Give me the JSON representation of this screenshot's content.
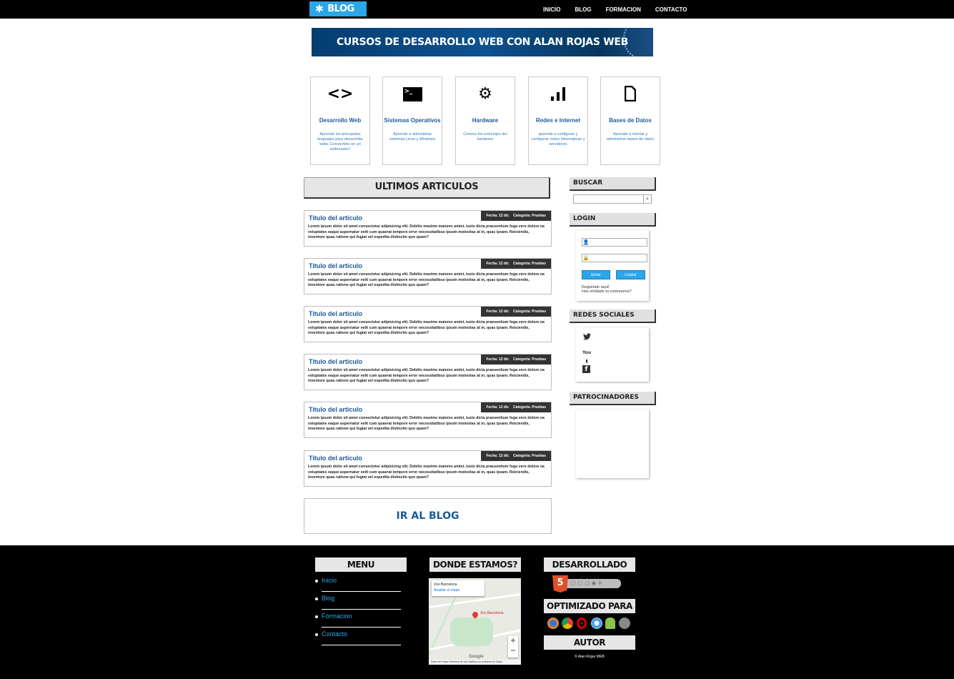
{
  "header": {
    "logo_label": "BLOG",
    "nav": [
      "INICIO",
      "BLOG",
      "FORMACION",
      "CONTACTO"
    ]
  },
  "banner": {
    "text": "CURSOS DE DESARROLLO WEB CON ALAN ROJAS WEB"
  },
  "categories": [
    {
      "icon": "code-icon",
      "title": "Desarrollo Web",
      "desc": "Aprende los principales lenguajes para desarrollar webs Conviertete en un webmaster!"
    },
    {
      "icon": "terminal-icon",
      "title": "Sistemas Operativos",
      "desc": "Aprende a administrar sistemas Linux y Windows"
    },
    {
      "icon": "gear-icon",
      "title": "Hardware",
      "desc": "Conoce los entresijos del hardware"
    },
    {
      "icon": "signal-bars-icon",
      "title": "Redes e Internet",
      "desc": "aprende a configurar y configurar redes informaticas y servidores"
    },
    {
      "icon": "file-icon",
      "title": "Bases de Datos",
      "desc": "Aprende a montar y administrar bases de datos"
    }
  ],
  "latest": {
    "heading": "ULTIMOS ARTICULOS",
    "articles": [
      {
        "title": "Titulo del articulo",
        "date": "Fecha: 12 dic",
        "category": "Categoria: Pruebas",
        "body": "Lorem ipsum dolor sit amet consectetur adipisicing elit. Debitis maxime maiores animi, iusto dicta praesentium fuga vero dolore ea voluptates eaque aspernatur velit cum quaerat tempore error necessitatibus ipsum molestias at in, quas ipsam. Reiciendis, inventore quas ratione qui fugiat vel expedita distinctio quo quam?"
      },
      {
        "title": "Titulo del articulo",
        "date": "Fecha: 12 dic",
        "category": "Categoria: Pruebas",
        "body": "Lorem ipsum dolor sit amet consectetur adipisicing elit. Debitis maxime maiores animi, iusto dicta praesentium fuga vero dolore ea voluptates eaque aspernatur velit cum quaerat tempore error necessitatibus ipsum molestias at in, quas ipsam. Reiciendis, inventore quas ratione qui fugiat vel expedita distinctio quo quam?"
      },
      {
        "title": "Titulo del articulo",
        "date": "Fecha: 12 dic",
        "category": "Categoria: Pruebas",
        "body": "Lorem ipsum dolor sit amet consectetur adipisicing elit. Debitis maxime maiores animi, iusto dicta praesentium fuga vero dolore ea voluptates eaque aspernatur velit cum quaerat tempore error necessitatibus ipsum molestias at in, quas ipsam. Reiciendis, inventore quas ratione qui fugiat vel expedita distinctio quo quam?"
      },
      {
        "title": "Titulo del articulo",
        "date": "Fecha: 12 dic",
        "category": "Categoria: Pruebas",
        "body": "Lorem ipsum dolor sit amet consectetur adipisicing elit. Debitis maxime maiores animi, iusto dicta praesentium fuga vero dolore ea voluptates eaque aspernatur velit cum quaerat tempore error necessitatibus ipsum molestias at in, quas ipsam. Reiciendis, inventore quas ratione qui fugiat vel expedita distinctio quo quam?"
      },
      {
        "title": "Titulo del articulo",
        "date": "Fecha: 12 dic",
        "category": "Categoria: Pruebas",
        "body": "Lorem ipsum dolor sit amet consectetur adipisicing elit. Debitis maxime maiores animi, iusto dicta praesentium fuga vero dolore ea voluptates eaque aspernatur velit cum quaerat tempore error necessitatibus ipsum molestias at in, quas ipsam. Reiciendis, inventore quas ratione qui fugiat vel expedita distinctio quo quam?"
      },
      {
        "title": "Titulo del articulo",
        "date": "Fecha: 12 dic",
        "category": "Categoria: Pruebas",
        "body": "Lorem ipsum dolor sit amet consectetur adipisicing elit. Debitis maxime maiores animi, iusto dicta praesentium fuga vero dolore ea voluptates eaque aspernatur velit cum quaerat tempore error necessitatibus ipsum molestias at in, quas ipsam. Reiciendis, inventore quas ratione qui fugiat vel expedita distinctio quo quam?"
      }
    ],
    "go_blog": "IR AL BLOG"
  },
  "sidebar": {
    "search_title": "BUSCAR",
    "login_title": "LOGIN",
    "login_enter": "Entrar",
    "login_clear": "Limpiar",
    "register": "Registrate aqui!",
    "forgot": "Has olvidado tu contrasena?",
    "social_title": "REDES SOCIALES",
    "sponsors_title": "PATROCINADORES"
  },
  "footer": {
    "menu_title": "MENU",
    "menu": [
      "Inicio",
      "Blog",
      "Formacion",
      "Contacto"
    ],
    "location_title": "DONDE ESTAMOS?",
    "map_place": "Zoo Barcelona",
    "map_enlarge": "Ampliar el mapa",
    "map_pin_label": "Zoo Barcelona",
    "map_footer": "Datos del mapa    Terminos de uso    Notificar un problema de Maps",
    "map_brand": "Google",
    "built_title": "DESARROLLADO CON",
    "optimized_title": "OPTIMIZADO PARA",
    "author_title": "AUTOR",
    "copyright": "© Alan Rojas WEB"
  },
  "colors": {
    "accent": "#2aa7e8",
    "link": "#1b5a9a",
    "dark": "#000000"
  }
}
